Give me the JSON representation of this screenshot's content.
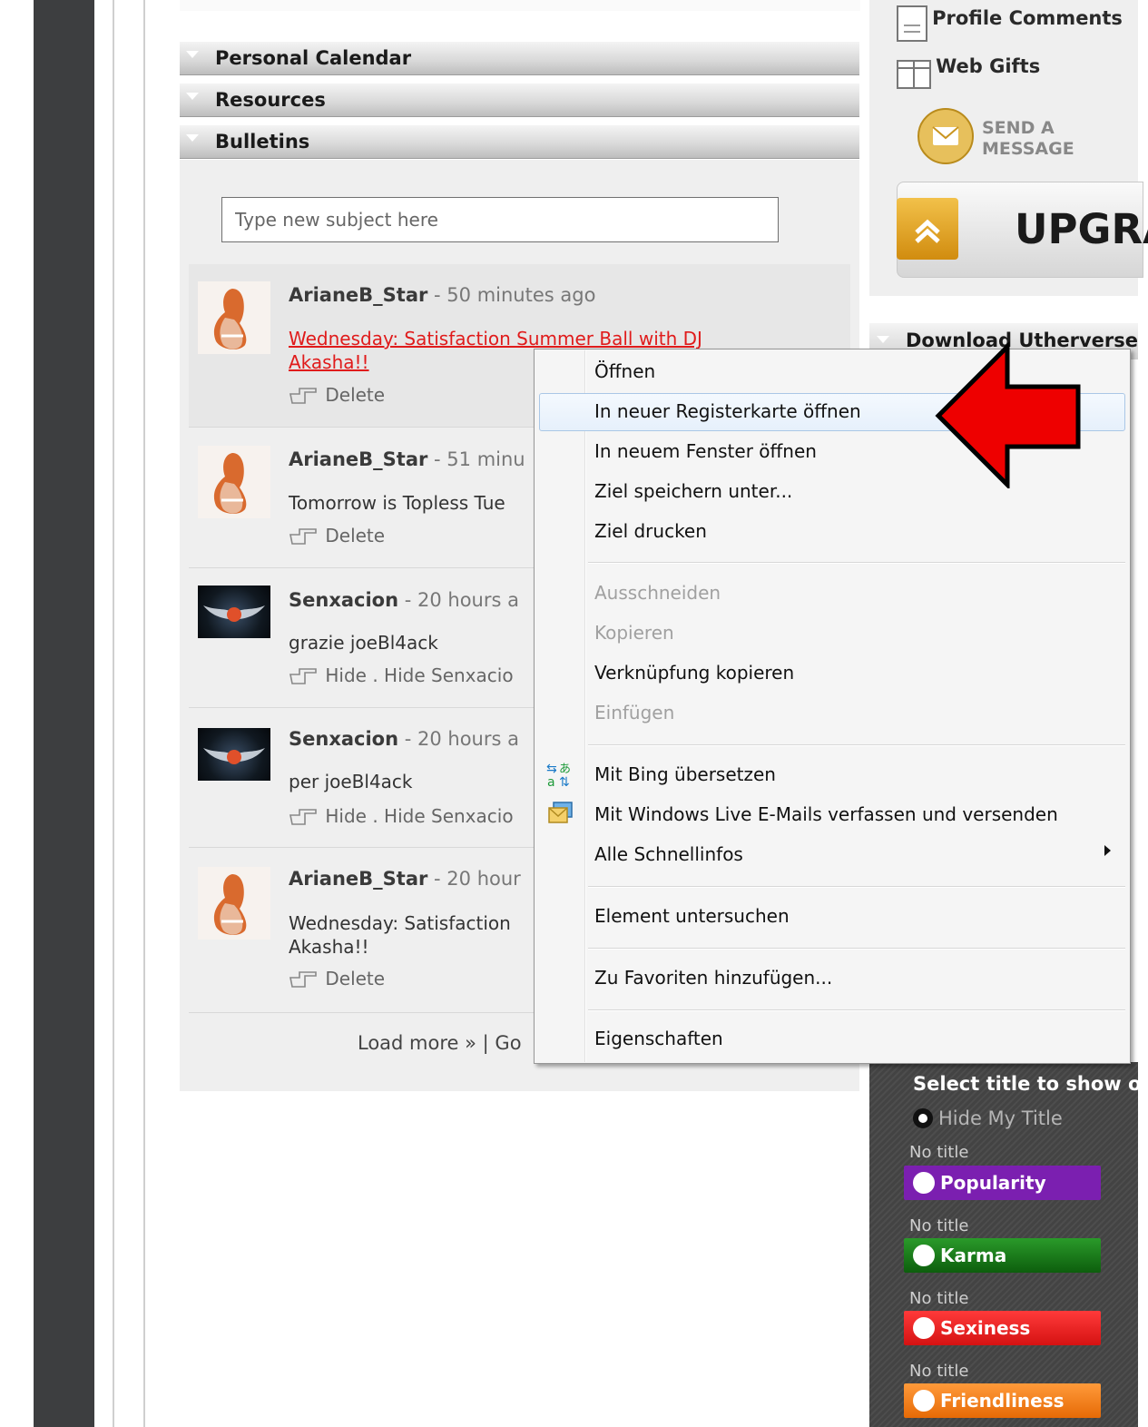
{
  "sections": {
    "personal_calendar": "Personal Calendar",
    "resources": "Resources",
    "bulletins": "Bulletins"
  },
  "bulletin_input": {
    "placeholder": "Type new subject here"
  },
  "bulletins": [
    {
      "author": "ArianeB_Star",
      "time": " - 50 minutes ago",
      "subject_line1": "Wednesday: Satisfaction Summer Ball with DJ",
      "subject_line2": "Akasha!!",
      "action": "Delete"
    },
    {
      "author": "ArianeB_Star",
      "time": " - 51 minu",
      "body": "Tomorrow is Topless Tue",
      "action": "Delete"
    },
    {
      "author": "Senxacion",
      "time": " - 20 hours a",
      "body": "grazie joeBl4ack",
      "action_hide": "Hide",
      "action_sep": " . ",
      "action_hide_user": "Hide Senxacio"
    },
    {
      "author": "Senxacion",
      "time": " - 20 hours a",
      "body": "per joeBl4ack",
      "action_hide": "Hide",
      "action_sep": " . ",
      "action_hide_user": "Hide Senxacio"
    },
    {
      "author": "ArianeB_Star",
      "time": " - 20 hour",
      "body_line1": "Wednesday: Satisfaction",
      "body_line2": "Akasha!!",
      "action": "Delete"
    }
  ],
  "load_more": {
    "link": "Load more »",
    "separator": " | ",
    "go": "Go"
  },
  "right_column": {
    "profile_comments": "Profile Comments",
    "web_gifts": "Web Gifts",
    "send_message_line1": "SEND A",
    "send_message_line2": "MESSAGE",
    "upgrade": "UPGRA",
    "download_header": "Download Utherverse"
  },
  "title_panel": {
    "heading": "Select title to show o",
    "hide_my_title": "Hide My Title",
    "options": [
      {
        "caption": "No title",
        "label": "Popularity",
        "color": "#7b1fb0"
      },
      {
        "caption": "No title",
        "label": "Karma",
        "color": "#1a7a1a"
      },
      {
        "caption": "No title",
        "label": "Sexiness",
        "color": "#e51e1e"
      },
      {
        "caption": "No title",
        "label": "Friendliness",
        "color": "#f07a12"
      }
    ]
  },
  "context_menu": {
    "open": "Öffnen",
    "open_new_tab": "In neuer Registerkarte öffnen",
    "open_new_window": "In neuem Fenster öffnen",
    "save_target": "Ziel speichern unter...",
    "print_target": "Ziel drucken",
    "cut": "Ausschneiden",
    "copy": "Kopieren",
    "copy_link": "Verknüpfung kopieren",
    "paste": "Einfügen",
    "bing_translate": "Mit Bing übersetzen",
    "live_mail": "Mit Windows Live E-Mails verfassen und versenden",
    "accelerators": "Alle Schnellinfos",
    "inspect": "Element untersuchen",
    "add_favorites": "Zu Favoriten hinzufügen...",
    "properties": "Eigenschaften"
  },
  "colors": {
    "accent_red": "#e01b1b",
    "annotation_arrow": "#ee0000",
    "menu_hover": "#e6f0fb"
  }
}
